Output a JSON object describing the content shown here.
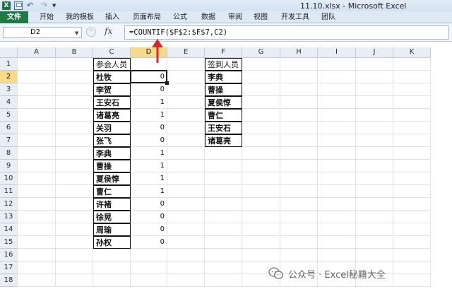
{
  "titlebar": {
    "app_icon": "excel-app-icon",
    "window_title": "11.10.xlsx - Microsoft Excel"
  },
  "ribbon": {
    "tabs": [
      "文件",
      "开始",
      "我的模板",
      "插入",
      "页面布局",
      "公式",
      "数据",
      "审阅",
      "视图",
      "开发工具",
      "团队"
    ]
  },
  "formula_bar": {
    "name_box": "D2",
    "fx_label": "fx",
    "formula": "=COUNTIF($F$2:$F$7,C2)"
  },
  "grid": {
    "columns": [
      "A",
      "B",
      "C",
      "D",
      "E",
      "F",
      "G",
      "H",
      "I",
      "J",
      "K"
    ],
    "active_column": "D",
    "rows": [
      "1",
      "2",
      "3",
      "4",
      "5",
      "6",
      "7",
      "8",
      "9",
      "10",
      "11",
      "12",
      "13",
      "14",
      "15",
      "16",
      "17",
      "18"
    ],
    "active_row": "2"
  },
  "participants": {
    "header": "参会人员",
    "names": [
      "杜牧",
      "李贺",
      "王安石",
      "诸葛亮",
      "关羽",
      "张飞",
      "李典",
      "曹操",
      "夏侯惇",
      "曹仁",
      "许褚",
      "徐晃",
      "周瑜",
      "孙权"
    ],
    "counts": [
      "0",
      "0",
      "1",
      "1",
      "0",
      "0",
      "1",
      "1",
      "1",
      "1",
      "0",
      "0",
      "0",
      "0"
    ]
  },
  "signed_in": {
    "header": "签到人员",
    "names": [
      "李典",
      "曹操",
      "夏侯惇",
      "曹仁",
      "王安石",
      "诸葛亮"
    ]
  },
  "watermark": {
    "text": "公众号 · Excel秘籍大全"
  },
  "colors": {
    "accent_file_tab": "#1f7a45",
    "active_header": "#f9d98a",
    "annotation_arrow": "#d8282a"
  }
}
